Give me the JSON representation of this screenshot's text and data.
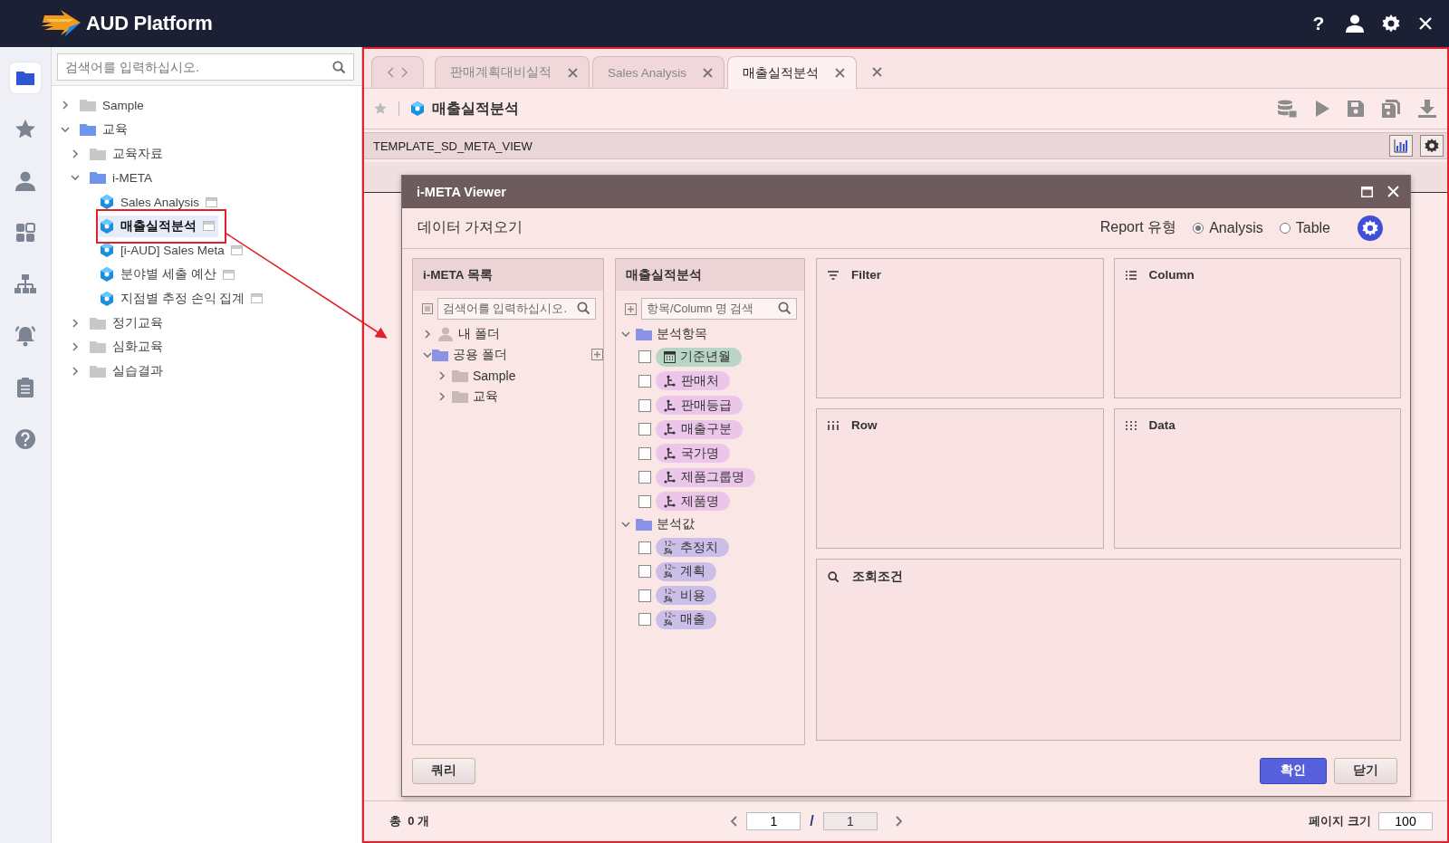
{
  "header": {
    "title": "AUD Platform",
    "help": "?"
  },
  "rail": [
    {
      "kind": "folder",
      "selected": true
    },
    {
      "kind": "star",
      "selected": false
    },
    {
      "kind": "user",
      "selected": false
    },
    {
      "kind": "dashboard",
      "selected": false
    },
    {
      "kind": "hierarchy",
      "selected": false
    },
    {
      "kind": "alarm",
      "selected": false
    },
    {
      "kind": "clipboard",
      "selected": false
    },
    {
      "kind": "help",
      "selected": false
    }
  ],
  "tree_search": {
    "placeholder": "검색어를 입력하십시오."
  },
  "tree": [
    {
      "label": "Sample",
      "kind": "folder",
      "expanded": false,
      "selected": false
    },
    {
      "label": "교육",
      "kind": "folder",
      "expanded": true,
      "selected": false,
      "children": [
        {
          "label": "교육자료",
          "kind": "folder",
          "expanded": false,
          "selected": false
        },
        {
          "label": "i-META",
          "kind": "folder",
          "expanded": true,
          "selected": false,
          "children": [
            {
              "label": "Sales Analysis",
              "kind": "meta",
              "selected": false
            },
            {
              "label": "매출실적분석",
              "kind": "meta",
              "selected": true
            },
            {
              "label": "[i-AUD] Sales Meta",
              "kind": "meta",
              "selected": false
            },
            {
              "label": "분야별 세출 예산",
              "kind": "meta",
              "selected": false
            },
            {
              "label": "지점별 추정 손익 집계",
              "kind": "meta",
              "selected": false
            }
          ]
        },
        {
          "label": "정기교육",
          "kind": "folder",
          "expanded": false,
          "selected": false
        },
        {
          "label": "심화교육",
          "kind": "folder",
          "expanded": false,
          "selected": false
        },
        {
          "label": "실습결과",
          "kind": "folder",
          "expanded": false,
          "selected": false
        }
      ]
    }
  ],
  "tabs": [
    {
      "label": "판매계획대비실적",
      "selected": false
    },
    {
      "label": "Sales Analysis",
      "selected": false
    },
    {
      "label": "매출실적분석",
      "selected": true
    }
  ],
  "toolbar": {
    "title": "매출실적분석"
  },
  "template": {
    "name": "TEMPLATE_SD_META_VIEW"
  },
  "dialog": {
    "title": "i-META Viewer",
    "heading": "데이터 가져오기",
    "report_type_label": "Report 유형",
    "report_types": [
      {
        "label": "Analysis",
        "selected": true
      },
      {
        "label": "Table",
        "selected": false
      }
    ],
    "meta_list": {
      "title": "i-META 목록",
      "search": {
        "placeholder": "검색어를 입력하십시오."
      },
      "tree": [
        {
          "label": "내 폴더",
          "kind": "user",
          "expanded": false,
          "selected": false
        },
        {
          "label": "공용 폴더",
          "kind": "folder",
          "expanded": true,
          "selected": false,
          "children": [
            {
              "label": "Sample",
              "kind": "folder",
              "expanded": false,
              "selected": false
            },
            {
              "label": "교육",
              "kind": "folder",
              "expanded": false,
              "selected": false
            }
          ]
        }
      ]
    },
    "fields": {
      "title": "매출실적분석",
      "search": {
        "placeholder": "항목/Column 명 검색"
      },
      "groups": [
        {
          "label": "분석항목",
          "expanded": true,
          "items": [
            {
              "label": "기준년월",
              "kind": "date",
              "checked": false
            },
            {
              "label": "판매처",
              "kind": "dimension",
              "checked": false
            },
            {
              "label": "판매등급",
              "kind": "dimension",
              "checked": false
            },
            {
              "label": "매출구분",
              "kind": "dimension",
              "checked": false
            },
            {
              "label": "국가명",
              "kind": "dimension",
              "checked": false
            },
            {
              "label": "제품그룹명",
              "kind": "dimension",
              "checked": false
            },
            {
              "label": "제품명",
              "kind": "dimension",
              "checked": false
            }
          ]
        },
        {
          "label": "분석값",
          "expanded": true,
          "items": [
            {
              "label": "추정치",
              "kind": "measure",
              "checked": false
            },
            {
              "label": "계획",
              "kind": "measure",
              "checked": false
            },
            {
              "label": "비용",
              "kind": "measure",
              "checked": false
            },
            {
              "label": "매출",
              "kind": "measure",
              "checked": false
            }
          ]
        }
      ]
    },
    "zones": [
      {
        "label": "Filter",
        "kind": "filter"
      },
      {
        "label": "Column",
        "kind": "column"
      },
      {
        "label": "Row",
        "kind": "row"
      },
      {
        "label": "Data",
        "kind": "data"
      },
      {
        "label": "조회조건",
        "kind": "condition"
      }
    ],
    "buttons": {
      "query": "쿼리",
      "ok": "확인",
      "close": "닫기"
    }
  },
  "status": {
    "total": "총  0 개",
    "page": "1",
    "separator": "/",
    "pages": "1",
    "page_size_label": "페이지 크기",
    "page_size": "100"
  }
}
